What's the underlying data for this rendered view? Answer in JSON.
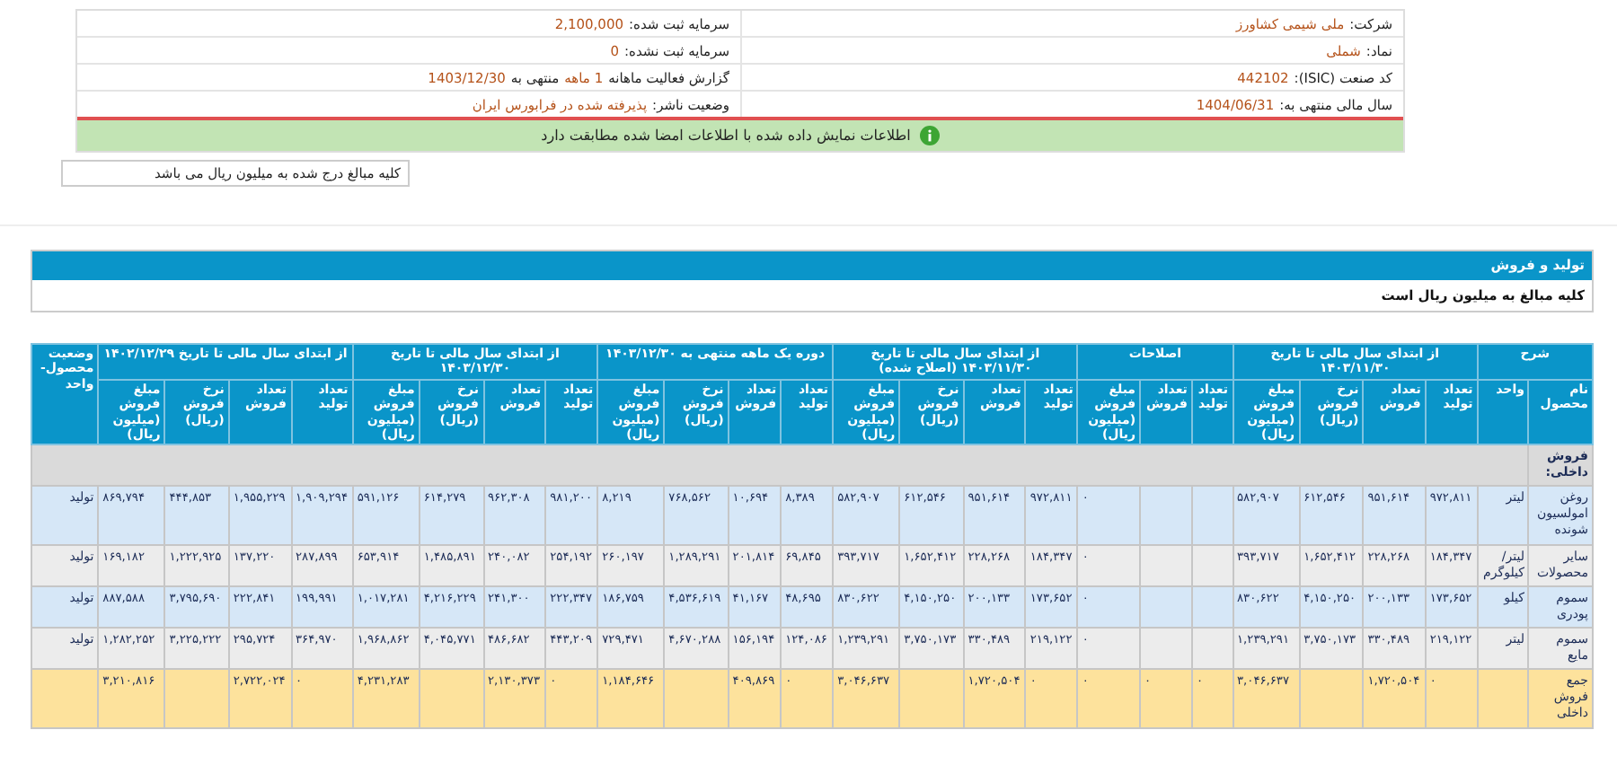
{
  "info_rows": [
    {
      "right": {
        "label": "شرکت:",
        "parts": [
          {
            "text": "ملی شیمی کشاورز",
            "highlight": true
          }
        ]
      },
      "left": {
        "label": "سرمایه ثبت شده:",
        "parts": [
          {
            "text": "2,100,000",
            "highlight": true
          }
        ]
      }
    },
    {
      "right": {
        "label": "نماد:",
        "parts": [
          {
            "text": "شملی",
            "highlight": true
          }
        ]
      },
      "left": {
        "label": "سرمایه ثبت نشده:",
        "parts": [
          {
            "text": "0",
            "highlight": true
          }
        ]
      }
    },
    {
      "right": {
        "label": "کد صنعت (ISIC):",
        "parts": [
          {
            "text": "442102",
            "highlight": true
          }
        ]
      },
      "left": {
        "label": "گزارش فعالیت ماهانه",
        "parts": [
          {
            "text": "1 ماهه",
            "highlight": true
          },
          {
            "text": "منتهی به",
            "highlight": false
          },
          {
            "text": "1403/12/30",
            "highlight": true
          }
        ]
      }
    },
    {
      "right": {
        "label": "سال مالی منتهی به:",
        "parts": [
          {
            "text": "1404/06/31",
            "highlight": true
          }
        ]
      },
      "left": {
        "label": "وضعیت ناشر:",
        "parts": [
          {
            "text": "پذیرفته شده در فرابورس ایران",
            "highlight": true
          }
        ]
      }
    }
  ],
  "notice": "اطلاعات نمایش داده شده با اطلاعات امضا شده مطابقت دارد",
  "amount_note": "کلیه مبالغ درج شده به میلیون ریال می باشد",
  "section": {
    "title": "تولید و فروش",
    "subtitle": "کلیه مبالغ به میلیون ریال است"
  },
  "table": {
    "groups": [
      {
        "label": "شرح",
        "columns": [
          "نام محصول",
          "واحد"
        ]
      },
      {
        "label": "از ابتدای سال مالی تا تاریخ ۱۴۰۳/۱۱/۳۰",
        "columns": [
          "تعداد تولید",
          "تعداد فروش",
          "نرخ فروش (ریال)",
          "مبلغ فروش (میلیون ریال)"
        ]
      },
      {
        "label": "اصلاحات",
        "columns": [
          "تعداد تولید",
          "تعداد فروش",
          "مبلغ فروش (میلیون ریال)"
        ]
      },
      {
        "label": "از ابتدای سال مالی تا تاریخ ۱۴۰۳/۱۱/۳۰ (اصلاح شده)",
        "columns": [
          "تعداد تولید",
          "تعداد فروش",
          "نرخ فروش (ریال)",
          "مبلغ فروش (میلیون ریال)"
        ]
      },
      {
        "label": "دوره یک ماهه منتهی به ۱۴۰۳/۱۲/۳۰",
        "columns": [
          "تعداد تولید",
          "تعداد فروش",
          "نرخ فروش (ریال)",
          "مبلغ فروش (میلیون ریال)"
        ]
      },
      {
        "label": "از ابتدای سال مالی تا تاریخ ۱۴۰۳/۱۲/۳۰",
        "columns": [
          "تعداد تولید",
          "تعداد فروش",
          "نرخ فروش (ریال)",
          "مبلغ فروش (میلیون ریال)"
        ]
      },
      {
        "label": "از ابتدای سال مالی تا تاریخ ۱۴۰۲/۱۲/۲۹",
        "columns": [
          "تعداد تولید",
          "تعداد فروش",
          "نرخ فروش (ریال)",
          "مبلغ فروش (میلیون ریال)"
        ]
      },
      {
        "label": "وضعیت محصول- واحد"
      }
    ],
    "rows": [
      {
        "kind": "section",
        "label": "فروش داخلی:"
      },
      {
        "kind": "item",
        "cells": [
          "روغن امولسیون شونده",
          "لیتر",
          "۹۷۲,۸۱۱",
          "۹۵۱,۶۱۴",
          "۶۱۲,۵۴۶",
          "۵۸۲,۹۰۷",
          null,
          null,
          "۰",
          "۹۷۲,۸۱۱",
          "۹۵۱,۶۱۴",
          "۶۱۲,۵۴۶",
          "۵۸۲,۹۰۷",
          "۸,۳۸۹",
          "۱۰,۶۹۴",
          "۷۶۸,۵۶۲",
          "۸,۲۱۹",
          "۹۸۱,۲۰۰",
          "۹۶۲,۳۰۸",
          "۶۱۴,۲۷۹",
          "۵۹۱,۱۲۶",
          "۱,۹۰۹,۲۹۴",
          "۱,۹۵۵,۲۲۹",
          "۴۴۴,۸۵۳",
          "۸۶۹,۷۹۴",
          "تولید"
        ]
      },
      {
        "kind": "item",
        "cells": [
          "سایر محصولات",
          "لیتر/ کیلوگرم",
          "۱۸۴,۳۴۷",
          "۲۲۸,۲۶۸",
          "۱,۶۵۲,۴۱۲",
          "۳۹۳,۷۱۷",
          null,
          null,
          "۰",
          "۱۸۴,۳۴۷",
          "۲۲۸,۲۶۸",
          "۱,۶۵۲,۴۱۲",
          "۳۹۳,۷۱۷",
          "۶۹,۸۴۵",
          "۲۰۱,۸۱۴",
          "۱,۲۸۹,۲۹۱",
          "۲۶۰,۱۹۷",
          "۲۵۴,۱۹۲",
          "۲۴۰,۰۸۲",
          "۱,۴۸۵,۸۹۱",
          "۶۵۳,۹۱۴",
          "۲۸۷,۸۹۹",
          "۱۳۷,۲۲۰",
          "۱,۲۲۲,۹۲۵",
          "۱۶۹,۱۸۲",
          "تولید"
        ]
      },
      {
        "kind": "item",
        "cells": [
          "سموم پودری",
          "کیلو",
          "۱۷۳,۶۵۲",
          "۲۰۰,۱۳۳",
          "۴,۱۵۰,۲۵۰",
          "۸۳۰,۶۲۲",
          null,
          null,
          "۰",
          "۱۷۳,۶۵۲",
          "۲۰۰,۱۳۳",
          "۴,۱۵۰,۲۵۰",
          "۸۳۰,۶۲۲",
          "۴۸,۶۹۵",
          "۴۱,۱۶۷",
          "۴,۵۳۶,۶۱۹",
          "۱۸۶,۷۵۹",
          "۲۲۲,۳۴۷",
          "۲۴۱,۳۰۰",
          "۴,۲۱۶,۲۲۹",
          "۱,۰۱۷,۲۸۱",
          "۱۹۹,۹۹۱",
          "۲۲۲,۸۴۱",
          "۳,۷۹۵,۶۹۰",
          "۸۸۷,۵۸۸",
          "تولید"
        ]
      },
      {
        "kind": "item",
        "cells": [
          "سموم مایع",
          "لیتر",
          "۲۱۹,۱۲۲",
          "۳۳۰,۴۸۹",
          "۳,۷۵۰,۱۷۳",
          "۱,۲۳۹,۲۹۱",
          null,
          null,
          "۰",
          "۲۱۹,۱۲۲",
          "۳۳۰,۴۸۹",
          "۳,۷۵۰,۱۷۳",
          "۱,۲۳۹,۲۹۱",
          "۱۲۴,۰۸۶",
          "۱۵۶,۱۹۴",
          "۴,۶۷۰,۲۸۸",
          "۷۲۹,۴۷۱",
          "۴۴۳,۲۰۹",
          "۴۸۶,۶۸۲",
          "۴,۰۴۵,۷۷۱",
          "۱,۹۶۸,۸۶۲",
          "۳۶۴,۹۷۰",
          "۲۹۵,۷۲۴",
          "۳,۲۲۵,۲۲۲",
          "۱,۲۸۲,۲۵۲",
          "تولید"
        ]
      },
      {
        "kind": "total",
        "cells": [
          "جمع فروش داخلی",
          null,
          "۰",
          "۱,۷۲۰,۵۰۴",
          null,
          "۳,۰۴۶,۶۳۷",
          "۰",
          "۰",
          "۰",
          "۰",
          "۱,۷۲۰,۵۰۴",
          null,
          "۳,۰۴۶,۶۳۷",
          "۰",
          "۴۰۹,۸۶۹",
          null,
          "۱,۱۸۴,۶۴۶",
          "۰",
          "۲,۱۳۰,۳۷۳",
          null,
          "۴,۲۳۱,۲۸۳",
          "۰",
          "۲,۷۲۲,۰۲۴",
          null,
          "۳,۲۱۰,۸۱۶",
          null
        ]
      }
    ]
  }
}
